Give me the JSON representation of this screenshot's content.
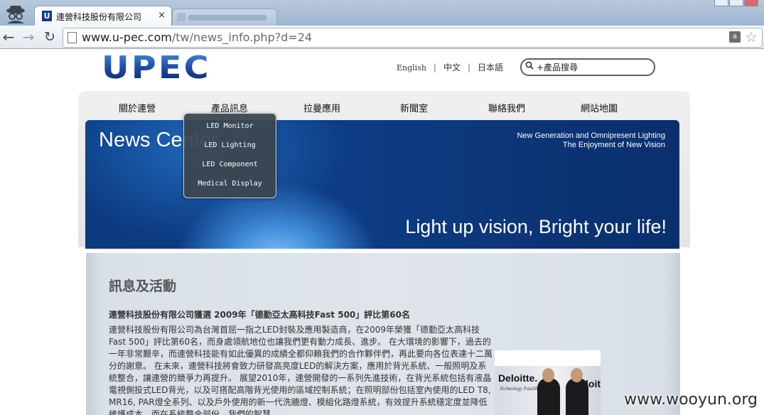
{
  "browser": {
    "tab_title": "連營科技股份有限公司",
    "tab_close": "×",
    "favicon_letter": "U",
    "url_host": "www.u-pec.com",
    "url_path": "/tw/news_info.php?d=24",
    "nav_back": "←",
    "nav_forward": "→",
    "nav_reload": "↻",
    "translate_glyph": "a",
    "bookmark_star": "☆"
  },
  "header": {
    "logo_text": "UPEC",
    "languages": [
      "English",
      "中文",
      "日本語"
    ],
    "language_separator": "|",
    "search_placeholder": "+產品搜尋"
  },
  "nav": {
    "items": [
      "關於連營",
      "產品訊息",
      "拉曼應用",
      "新聞室",
      "聯絡我們",
      "網站地圖"
    ]
  },
  "dropdown": {
    "items": [
      "LED Monitor",
      "LED Lighting",
      "LED Component",
      "Medical Display"
    ]
  },
  "banner": {
    "title": "News Center",
    "tagline_1": "New Generation and Omnipresent Lighting",
    "tagline_2": "The Enjoyment of New Vision",
    "slogan": "Light up vision, Bright your life!"
  },
  "content": {
    "section_heading": "訊息及活動",
    "article_title": "連營科技股份有限公司獲選 2009年「德勤亞太高科技Fast 500」評比第60名",
    "article_body": "連營科技股份有限公司為台灣首屈一指之LED封裝及應用製造商，在2009年榮獲「德勤亞太高科技Fast 500」評比第60名，而身處領航地位也讓我們更有動力成長、進步。 在大環境的影響下，過去的一年非常艱辛，而連營科技能有如此優異的成績全都仰賴我們的合作夥伴們，再此要向各位表達十二萬分的謝意。 在未來，連營科技將會致力研發高亮度LED的解決方案，應用於背光系統、一般照明及系統整合，讓連營的競爭力再提升。 展望2010年，連營開發的一系列先進技術，在背光系統包括有液晶電視側投式LED背光，以及可搭配高階背光使用的區域控制系統；在照明部份包括室內使用的LED T8, MR16, PAR燈全系列、以及戶外使用的新一代洗牆燈、模組化路燈系統，有效提升系統穩定度並降低維護成本。而在系統整合部份，我們的智慧"
  },
  "photo": {
    "brand": "Deloitte.",
    "subtitle": "Technology Fast500",
    "brand_repeat": "loitte"
  },
  "watermark": "www.wooyun.org"
}
